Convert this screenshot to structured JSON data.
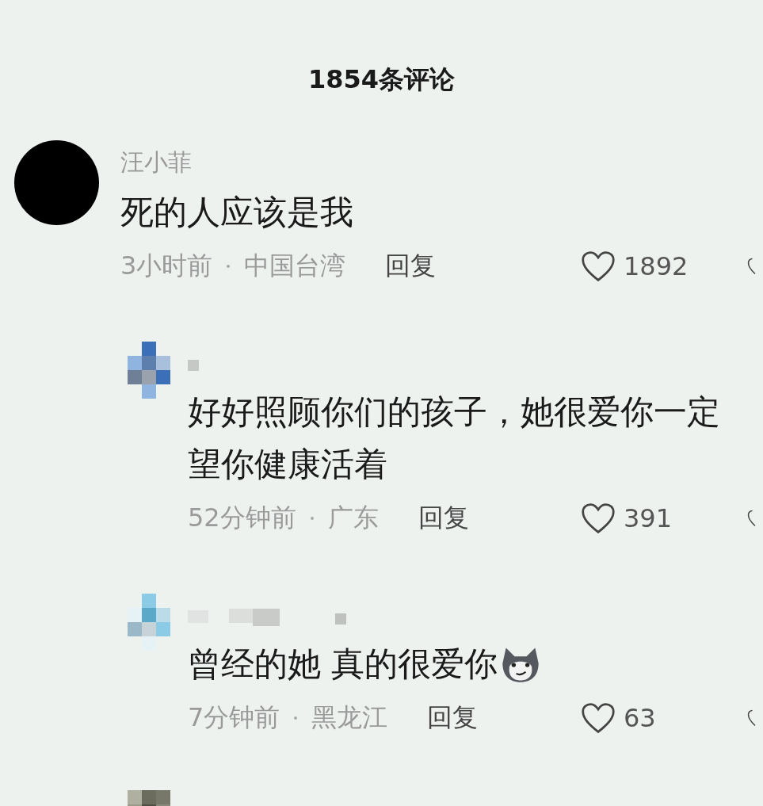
{
  "title": "1854条评论",
  "comments": [
    {
      "avatar": {
        "kind": "solid"
      },
      "author": {
        "kind": "name",
        "text": "汪小菲"
      },
      "lines": [
        "死的人应该是我"
      ],
      "has_emoji": false,
      "time": "3小时前",
      "location": "中国台湾",
      "reply": "回复",
      "likes": "1892",
      "replies": [
        {
          "avatar": {
            "kind": "mosaic"
          },
          "author": {
            "kind": "blurred"
          },
          "lines": [
            "好好照顾你们的孩子，她很爱你一定",
            "望你健康活着"
          ],
          "has_emoji": false,
          "time": "52分钟前",
          "location": "广东",
          "reply": "回复",
          "likes": "391"
        },
        {
          "avatar": {
            "kind": "mosaic"
          },
          "author": {
            "kind": "blurred"
          },
          "lines": [
            "曾经的她 真的很爱你"
          ],
          "has_emoji": true,
          "time": "7分钟前",
          "location": "黑龙江",
          "reply": "回复",
          "likes": "63"
        },
        {
          "avatar": {
            "kind": "mosaic"
          }
        }
      ]
    }
  ]
}
